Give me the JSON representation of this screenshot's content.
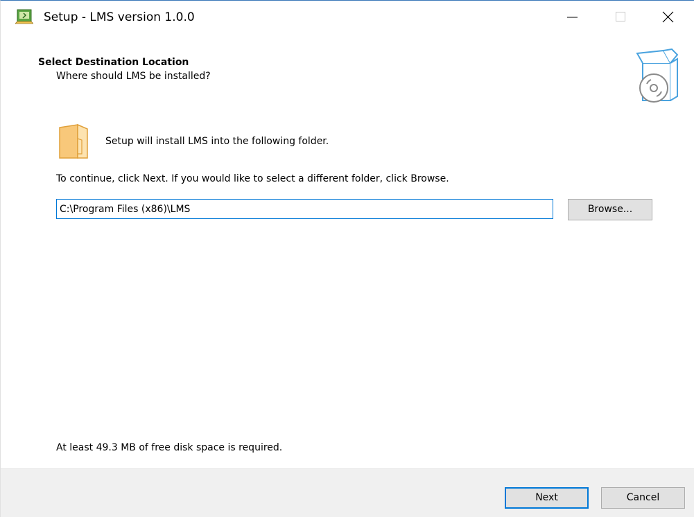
{
  "window": {
    "title": "Setup - LMS version 1.0.0",
    "controls": {
      "minimize_icon": "minimize-icon",
      "maximize_icon": "maximize-icon",
      "close_icon": "close-icon"
    }
  },
  "header": {
    "title": "Select Destination Location",
    "subtitle": "Where should LMS be installed?",
    "icon": "software-box-icon"
  },
  "main": {
    "folder_icon": "folder-icon",
    "info_text": "Setup will install LMS into the following folder.",
    "continue_text": "To continue, click Next. If you would like to select a different folder, click Browse.",
    "path_value": "C:\\Program Files (x86)\\LMS",
    "browse_label": "Browse...",
    "disk_space_text": "At least 49.3 MB of free disk space is required."
  },
  "footer": {
    "next_label": "Next",
    "cancel_label": "Cancel"
  },
  "colors": {
    "accent": "#0078d7",
    "button_bg": "#e1e1e1",
    "footer_bg": "#f0f0f0",
    "folder": "#f8c87a"
  }
}
